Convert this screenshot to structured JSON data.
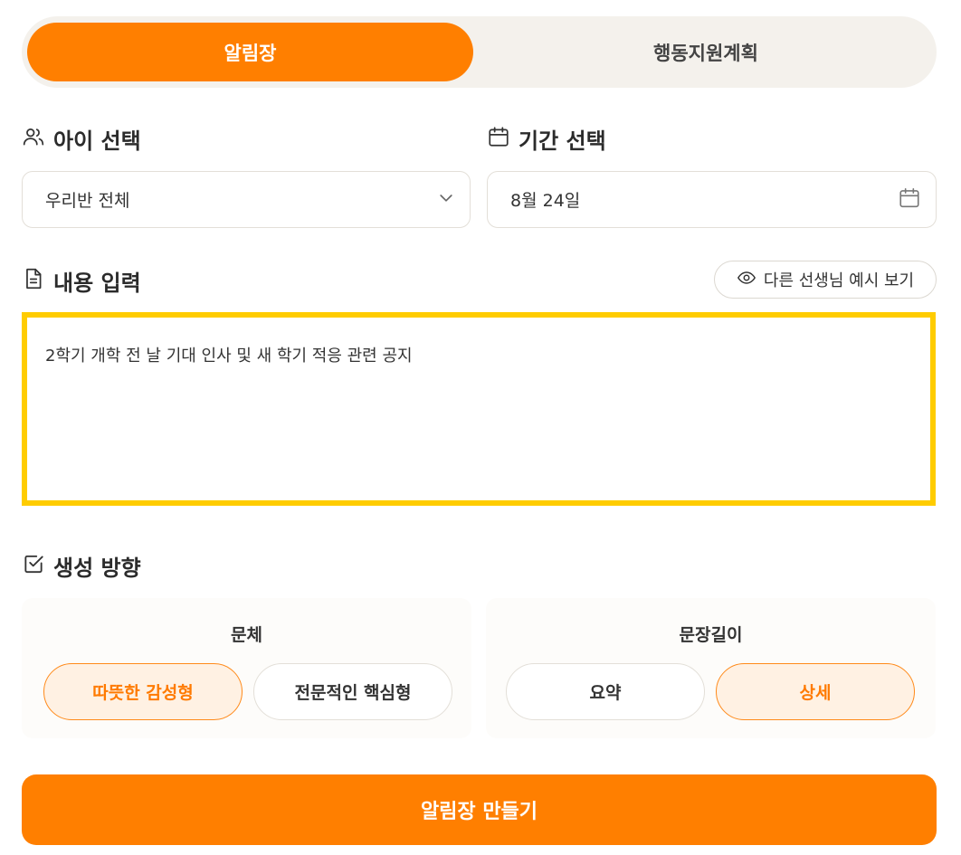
{
  "tabs": [
    {
      "label": "알림장",
      "active": true
    },
    {
      "label": "행동지원계획",
      "active": false
    }
  ],
  "child_select": {
    "title": "아이 선택",
    "icon": "users-icon",
    "value": "우리반 전체"
  },
  "period_select": {
    "title": "기간 선택",
    "icon": "calendar-icon",
    "value": "8월 24일"
  },
  "content": {
    "title": "내용 입력",
    "icon": "document-icon",
    "example_button": "다른 선생님 예시 보기",
    "text": "2학기 개학 전 날 기대 인사 및 새 학기 적응 관련 공지"
  },
  "generation": {
    "title": "생성 방향",
    "icon": "checkbox-icon",
    "style": {
      "title": "문체",
      "options": [
        "따뜻한 감성형",
        "전문적인 핵심형"
      ],
      "selected": "따뜻한 감성형"
    },
    "length": {
      "title": "문장길이",
      "options": [
        "요약",
        "상세"
      ],
      "selected": "상세"
    }
  },
  "submit_label": "알림장 만들기",
  "colors": {
    "accent": "#ff7f00",
    "highlight_border": "#ffcc00",
    "selected_bg": "#fff1e3"
  }
}
